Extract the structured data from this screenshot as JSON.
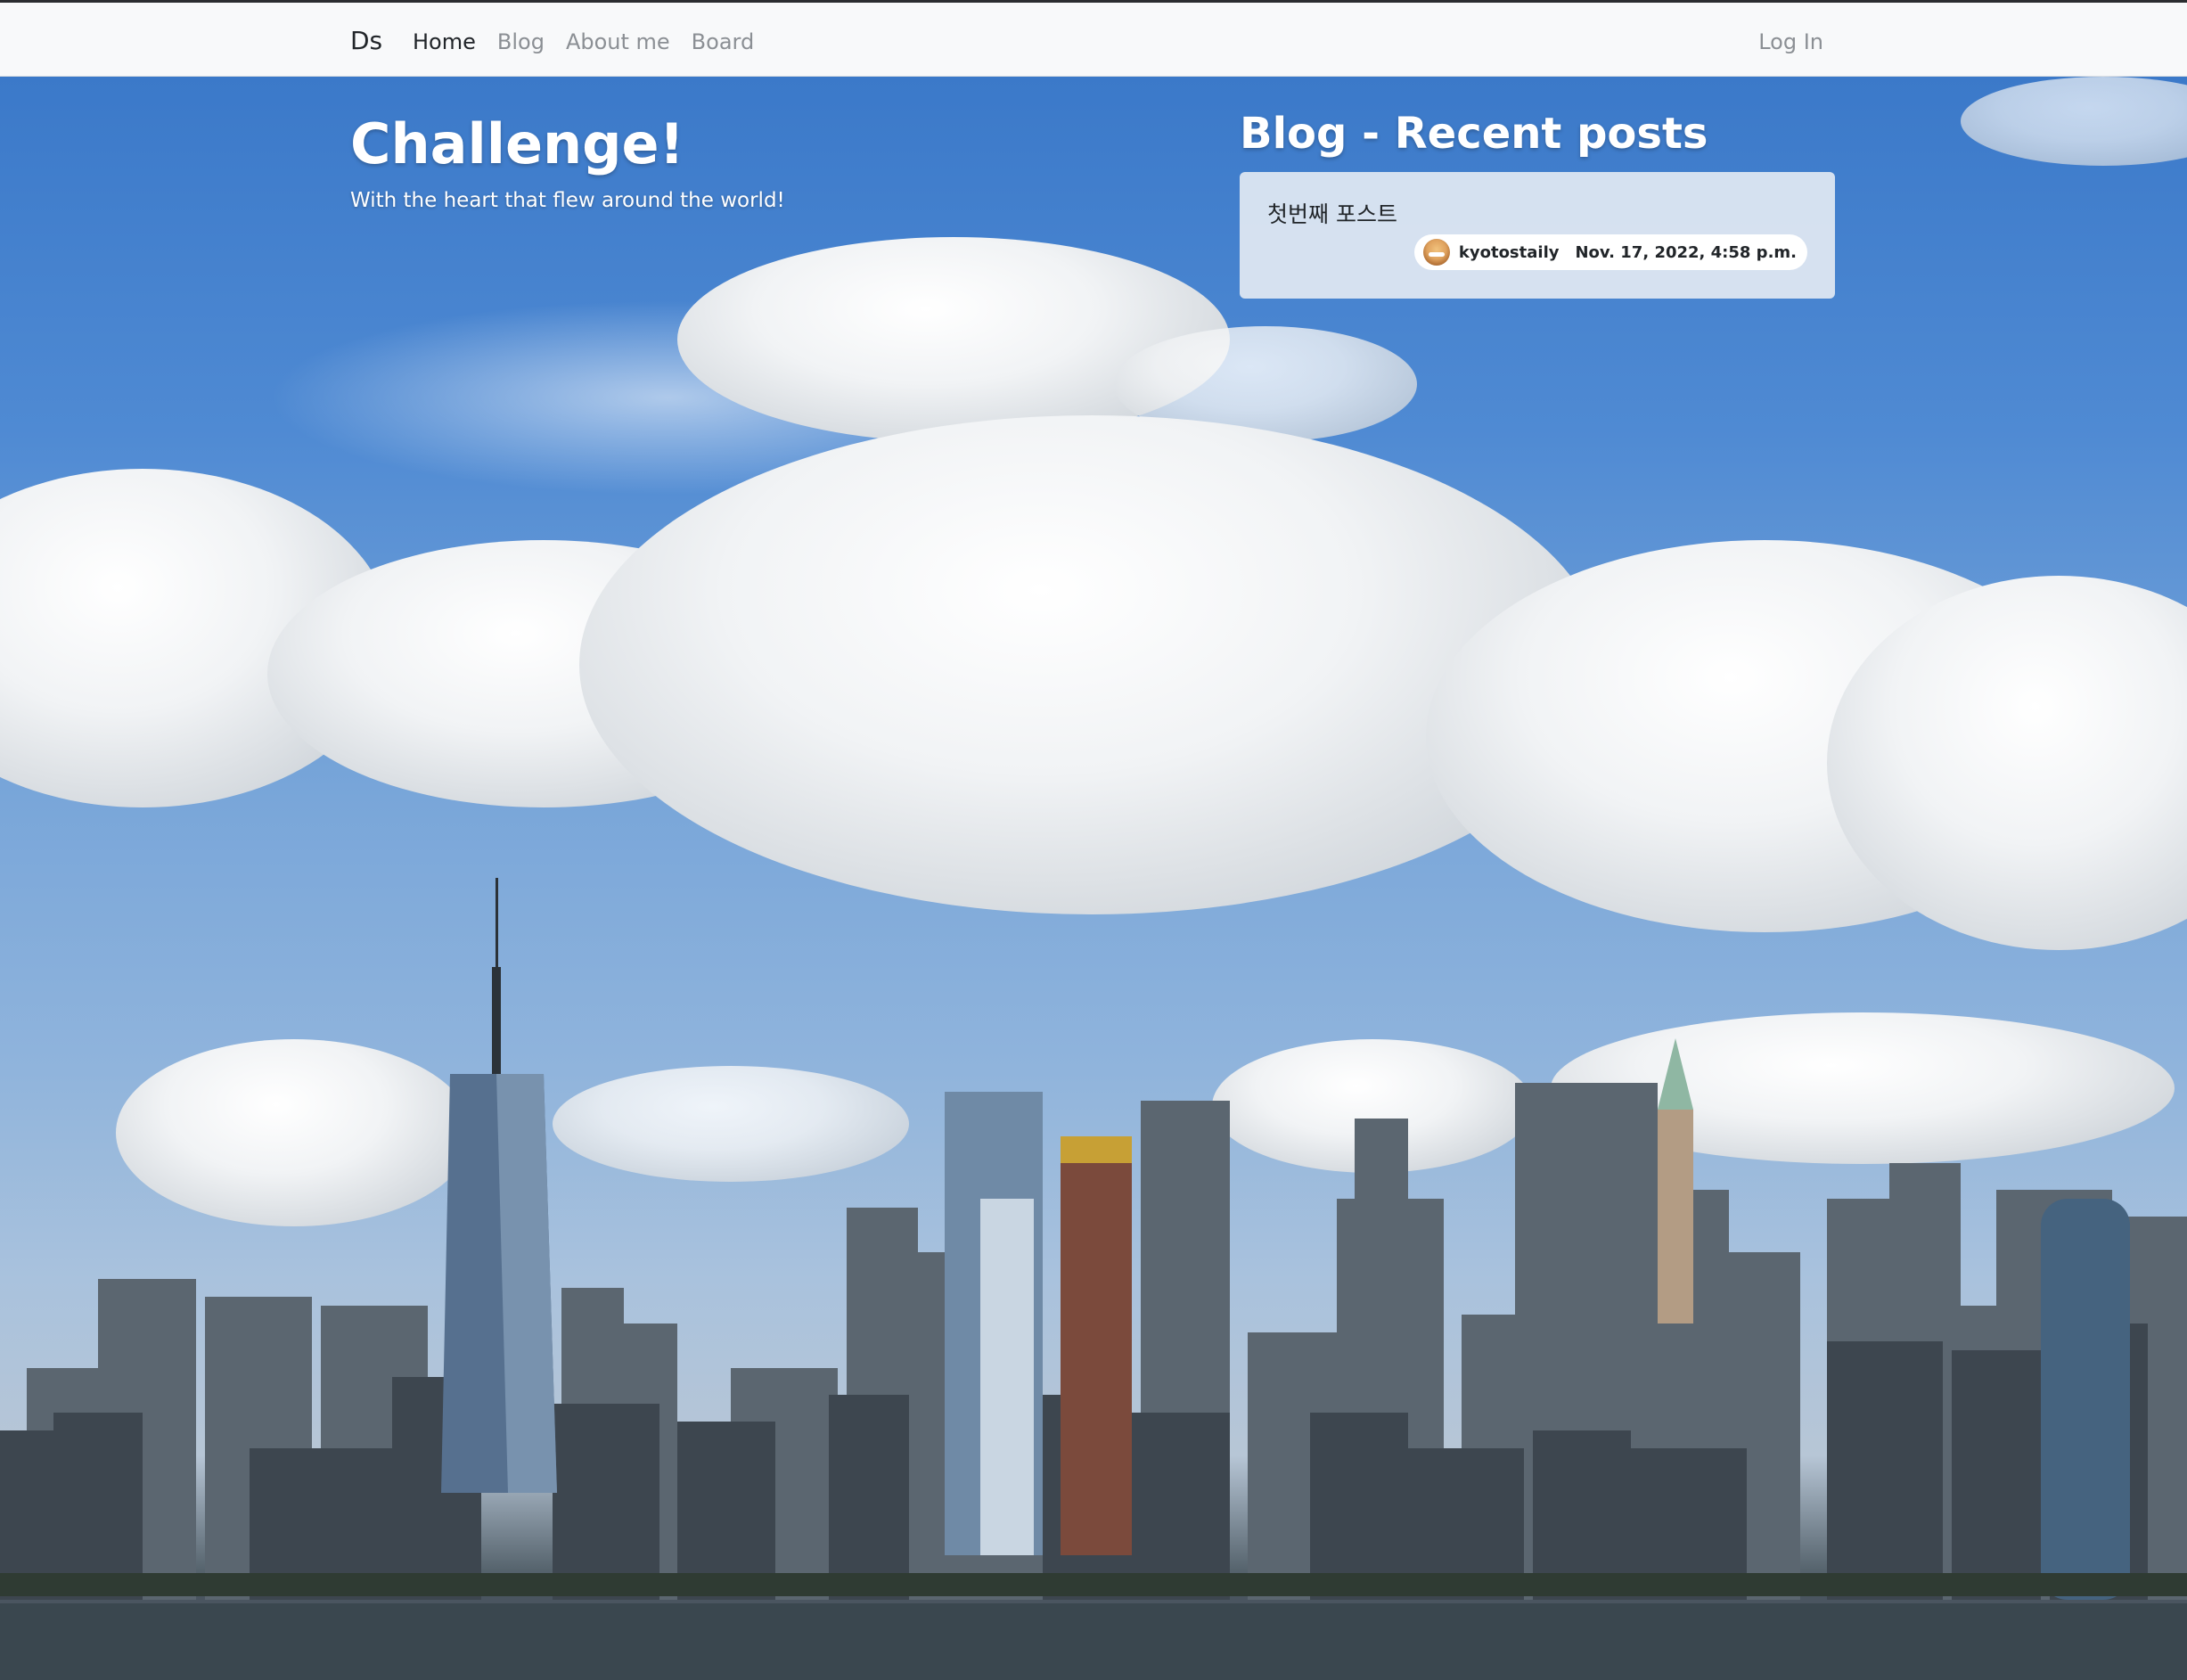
{
  "navbar": {
    "brand": "Ds",
    "links": [
      {
        "label": "Home",
        "active": true
      },
      {
        "label": "Blog",
        "active": false
      },
      {
        "label": "About me",
        "active": false
      },
      {
        "label": "Board",
        "active": false
      }
    ],
    "login": "Log In"
  },
  "hero": {
    "title": "Challenge!",
    "subtitle": "With the heart that flew around the world!"
  },
  "recent_posts": {
    "heading": "Blog - Recent posts",
    "posts": [
      {
        "title": "첫번째 포스트",
        "author": "kyotostaily",
        "date": "Nov. 17, 2022, 4:58 p.m."
      }
    ]
  },
  "colors": {
    "navbar_bg": "#f8f9fa",
    "text_dark": "#212529",
    "nav_muted": "#8b8f94",
    "card_bg": "#e1e8f2"
  },
  "icons": {
    "author_avatar": "user-avatar-icon"
  }
}
